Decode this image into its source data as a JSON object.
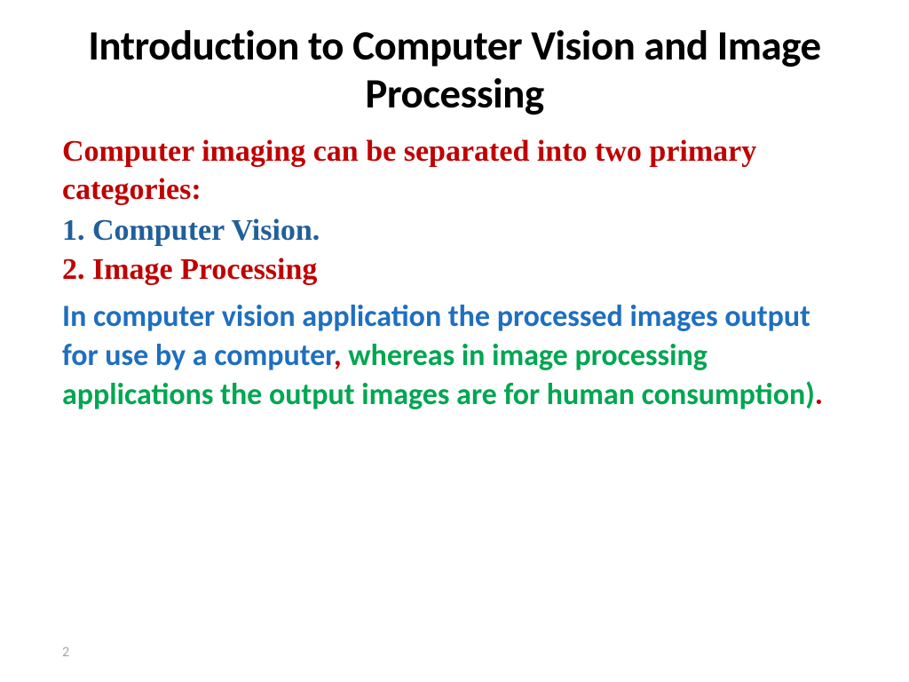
{
  "slide": {
    "title": "Introduction to Computer Vision and Image Processing",
    "intro": "Computer imaging can be separated into two primary categories:",
    "item1": "1. Computer Vision.",
    "item2": "2. Image Processing",
    "explanation": {
      "part1": "In computer vision application the processed images output for use by a computer",
      "comma": ", ",
      "part2": "whereas in image processing applications the output images are for human consumption)",
      "period": "."
    },
    "pageNumber": "2"
  }
}
